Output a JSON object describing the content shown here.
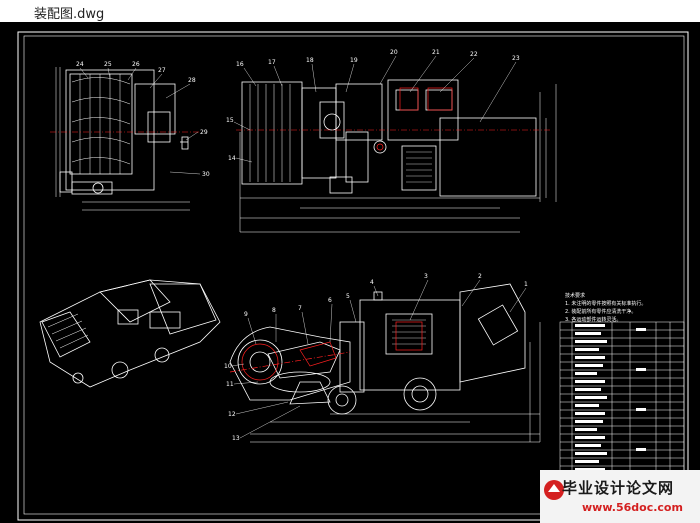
{
  "window": {
    "title": "装配图.dwg"
  },
  "colors": {
    "background": "#000000",
    "line": "#ffffff",
    "center": "#ff2020",
    "dim": "#e8e8e8"
  },
  "callouts_top_left": [
    "24",
    "25",
    "26",
    "27",
    "28",
    "29",
    "30"
  ],
  "callouts_top_right": [
    "16",
    "17",
    "18",
    "19",
    "20",
    "21",
    "22",
    "23",
    "15",
    "14"
  ],
  "callouts_bottom": [
    "1",
    "2",
    "3",
    "4",
    "5",
    "6",
    "7",
    "8",
    "9",
    "10",
    "11",
    "12",
    "13"
  ],
  "notes": {
    "heading": "技术要求",
    "lines": [
      "1. 未注明的零件按照有关标准执行。",
      "2. 装配前所有零件应清洗干净。",
      "3. 各运动部件运转灵活。"
    ]
  },
  "watermark": {
    "main": "毕业设计论文网",
    "url": "www.56doc.com"
  }
}
